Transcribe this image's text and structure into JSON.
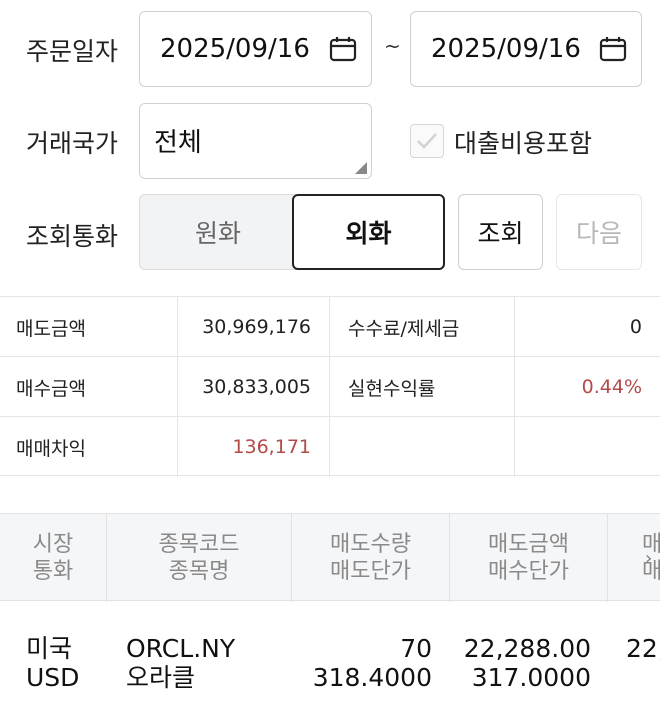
{
  "filters": {
    "order_date_label": "주문일자",
    "start_date": "2025/09/16",
    "date_separator": "~",
    "end_date": "2025/09/16",
    "country_label": "거래국가",
    "country_value": "전체",
    "include_loan_cost_label": "대출비용포함",
    "include_loan_cost_checked": false,
    "currency_label": "조회통화",
    "currency_won": "원화",
    "currency_foreign": "외화",
    "selected_currency": "외화",
    "query_button": "조회",
    "next_button": "다음"
  },
  "summary": {
    "rows": [
      {
        "label1": "매도금액",
        "value1": "30,969,176",
        "label2": "수수료/제세금",
        "value2": "0"
      },
      {
        "label1": "매수금액",
        "value1": "30,833,005",
        "label2": "실현수익률",
        "value2": "0.44%"
      },
      {
        "label1": "매매차익",
        "value1": "136,171",
        "label2": "",
        "value2": ""
      }
    ]
  },
  "grid": {
    "headers": [
      {
        "line1": "시장",
        "line2": "통화"
      },
      {
        "line1": "종목코드",
        "line2": "종목명"
      },
      {
        "line1": "매도수량",
        "line2": "매도단가"
      },
      {
        "line1": "매도금액",
        "line2": "매수단가"
      },
      {
        "line1": "매",
        "line2": "매"
      }
    ],
    "rows": [
      {
        "market": "미국",
        "currency": "USD",
        "code": "ORCL.NY",
        "name": "오라클",
        "sell_qty": "70",
        "sell_price": "318.4000",
        "sell_amount": "22,288.00",
        "buy_price": "317.0000",
        "next_col": "22,"
      }
    ]
  },
  "colors": {
    "profit_red": "#b24a4a",
    "border": "#e5e5e5",
    "header_bg": "#f5f6f8"
  }
}
